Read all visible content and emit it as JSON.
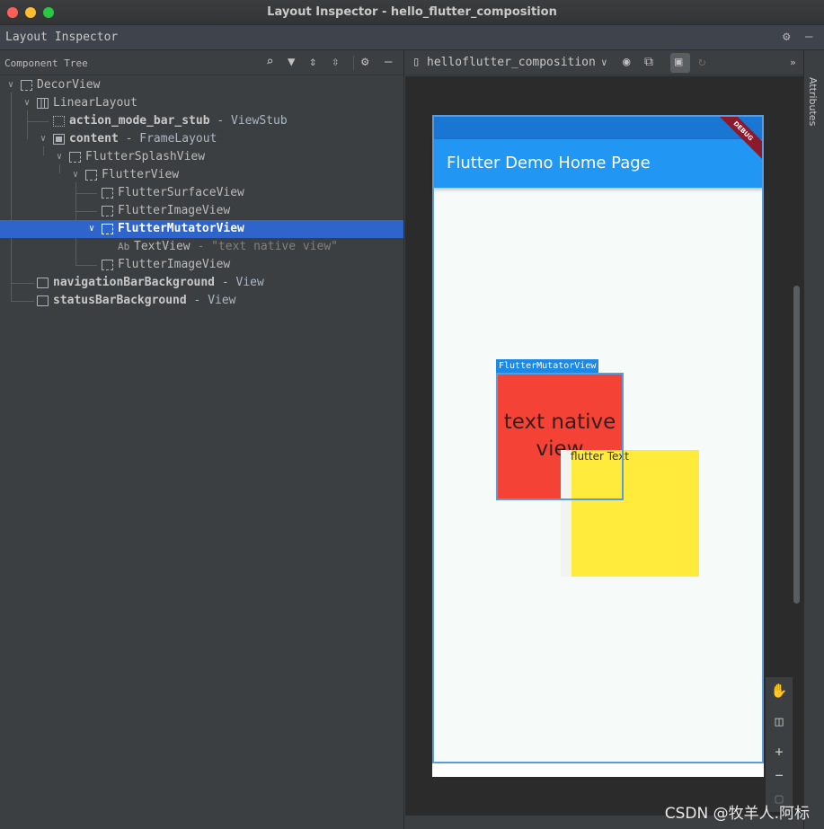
{
  "window": {
    "title": "Layout Inspector - hello_flutter_composition"
  },
  "tool": {
    "title": "Layout Inspector",
    "settings_icon": "gear-icon",
    "hide_icon": "minus-icon"
  },
  "component_tree": {
    "title": "Component Tree",
    "toolbar_icons": [
      "search-icon",
      "filter-icon",
      "expand-all-icon",
      "collapse-all-icon",
      "gear-icon",
      "minus-icon"
    ],
    "nodes": [
      {
        "name": "DecorView",
        "suffix": ""
      },
      {
        "name": "LinearLayout",
        "suffix": ""
      },
      {
        "name": "action_mode_bar_stub",
        "suffix": " - ViewStub"
      },
      {
        "name": "content",
        "suffix": " - FrameLayout"
      },
      {
        "name": "FlutterSplashView",
        "suffix": ""
      },
      {
        "name": "FlutterView",
        "suffix": ""
      },
      {
        "name": "FlutterSurfaceView",
        "suffix": ""
      },
      {
        "name": "FlutterImageView",
        "suffix": ""
      },
      {
        "name": "FlutterMutatorView",
        "suffix": ""
      },
      {
        "name": "TextView",
        "suffix": " - \"text native view\"",
        "badge": "Ab"
      },
      {
        "name": "FlutterImageView",
        "suffix": ""
      },
      {
        "name": "navigationBarBackground",
        "suffix": " - View"
      },
      {
        "name": "statusBarBackground",
        "suffix": " - View"
      }
    ]
  },
  "preview": {
    "process": "helloflutter_composition",
    "app_title": "Flutter Demo Home Page",
    "debug_banner": "DEBUG",
    "native_text": "text native view",
    "flutter_text": "flutter Text",
    "mutator_label": "FlutterMutatorView",
    "zoom_in": "+",
    "zoom_out": "−"
  },
  "attributes": {
    "title": "Attributes"
  },
  "watermark": "CSDN @牧羊人.阿标",
  "colors": {
    "selection": "#2f65ca",
    "app_bar": "#2196f3",
    "status_bar": "#1976d2",
    "native_box": "#f44336",
    "flutter_box": "#ffeb3b",
    "outline": "#5b9bdc"
  }
}
